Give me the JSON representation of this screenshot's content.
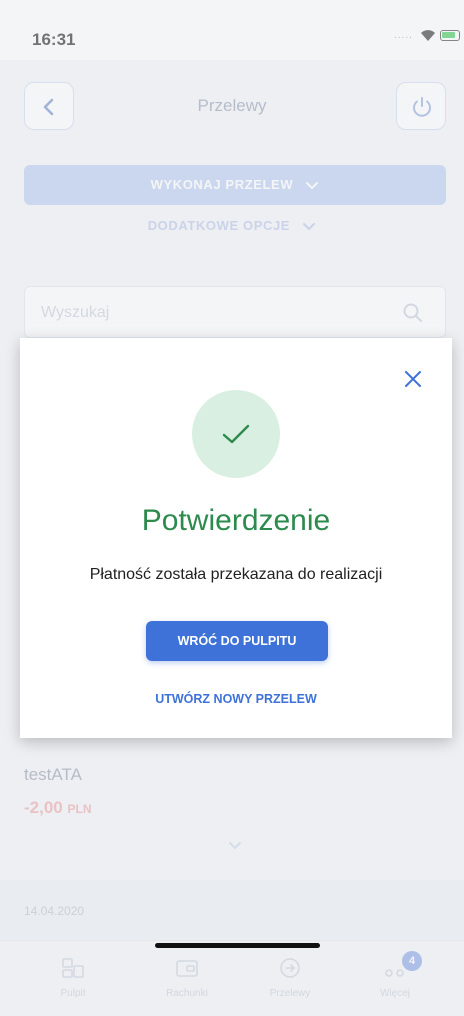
{
  "status": {
    "time": "16:31",
    "signal": "....."
  },
  "header": {
    "title": "Przelewy"
  },
  "actions": {
    "primary": "WYKONAJ PRZELEW",
    "secondary": "DODATKOWE OPCJE"
  },
  "search": {
    "placeholder": "Wyszukaj"
  },
  "transaction": {
    "title": "testATA",
    "amount": "-2,00",
    "currency": "PLN",
    "date": "14.04.2020"
  },
  "tabbar": {
    "items": [
      {
        "label": "Pulpit",
        "icon": "dashboard-icon"
      },
      {
        "label": "Rachunki",
        "icon": "wallet-icon"
      },
      {
        "label": "Przelewy",
        "icon": "transfer-icon"
      },
      {
        "label": "Więcej",
        "icon": "more-icon",
        "badge": "4"
      }
    ]
  },
  "modal": {
    "title": "Potwierdzenie",
    "message": "Płatność została przekazana do realizacji",
    "primary_button": "WRÓĆ DO PULPITU",
    "secondary_link": "UTWÓRZ NOWY PRZELEW"
  },
  "colors": {
    "accent": "#3f72d9",
    "success": "#2d8a4d",
    "success_bg": "#d9efe2",
    "negative": "#e9a3a3"
  }
}
